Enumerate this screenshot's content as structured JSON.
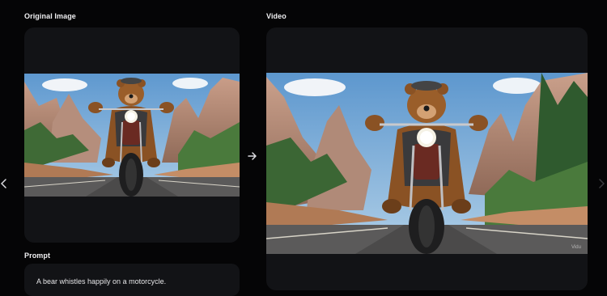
{
  "original": {
    "label": "Original Image"
  },
  "video": {
    "label": "Video",
    "watermark": "Vidu"
  },
  "prompt": {
    "label": "Prompt",
    "text": "A bear whistles happily on a motorcycle."
  },
  "icons": {
    "prev": "chevron-left-icon",
    "arrow": "arrow-right-icon",
    "next": "chevron-right-icon"
  },
  "colors": {
    "background": "#050506",
    "panel": "#121316",
    "sky": "#6fa6d8",
    "road": "#5b5a5a"
  }
}
